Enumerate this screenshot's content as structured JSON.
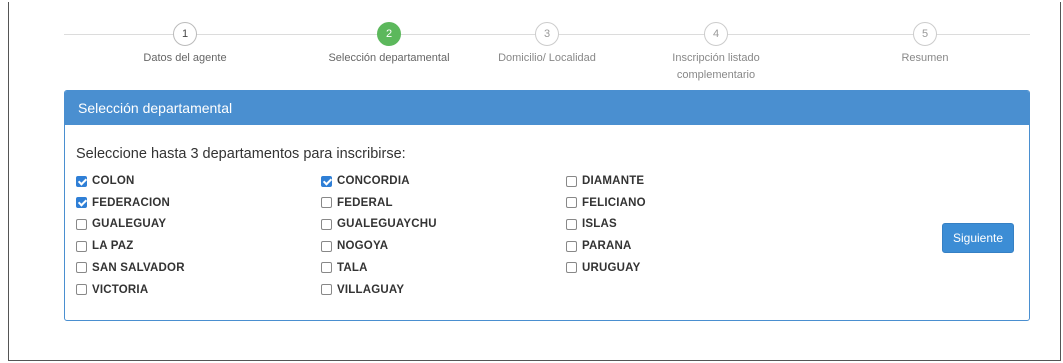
{
  "wizard": {
    "steps": [
      {
        "number": "1",
        "label": "Datos del agente"
      },
      {
        "number": "2",
        "label": "Selección departamental"
      },
      {
        "number": "3",
        "label": "Domicilio/ Localidad"
      },
      {
        "number": "4",
        "label_line1": "Inscripción listado",
        "label_line2": "complementario"
      },
      {
        "number": "5",
        "label": "Resumen"
      }
    ],
    "active_step": 2,
    "active_color": "#5cb85c"
  },
  "panel": {
    "title": "Selección departamental",
    "header_color": "#4a8fd0",
    "prompt": "Seleccione hasta 3 departamentos para inscribirse:",
    "departments": [
      {
        "name": "COLON",
        "checked": true
      },
      {
        "name": "CONCORDIA",
        "checked": true
      },
      {
        "name": "DIAMANTE",
        "checked": false
      },
      {
        "name": "FEDERACION",
        "checked": true
      },
      {
        "name": "FEDERAL",
        "checked": false
      },
      {
        "name": "FELICIANO",
        "checked": false
      },
      {
        "name": "GUALEGUAY",
        "checked": false
      },
      {
        "name": "GUALEGUAYCHU",
        "checked": false
      },
      {
        "name": "ISLAS",
        "checked": false
      },
      {
        "name": "LA PAZ",
        "checked": false
      },
      {
        "name": "NOGOYA",
        "checked": false
      },
      {
        "name": "PARANA",
        "checked": false
      },
      {
        "name": "SAN SALVADOR",
        "checked": false
      },
      {
        "name": "TALA",
        "checked": false
      },
      {
        "name": "URUGUAY",
        "checked": false
      },
      {
        "name": "VICTORIA",
        "checked": false
      },
      {
        "name": "VILLAGUAY",
        "checked": false
      }
    ],
    "next_button": "Siguiente",
    "checkbox_color": "#2f7fd6"
  }
}
